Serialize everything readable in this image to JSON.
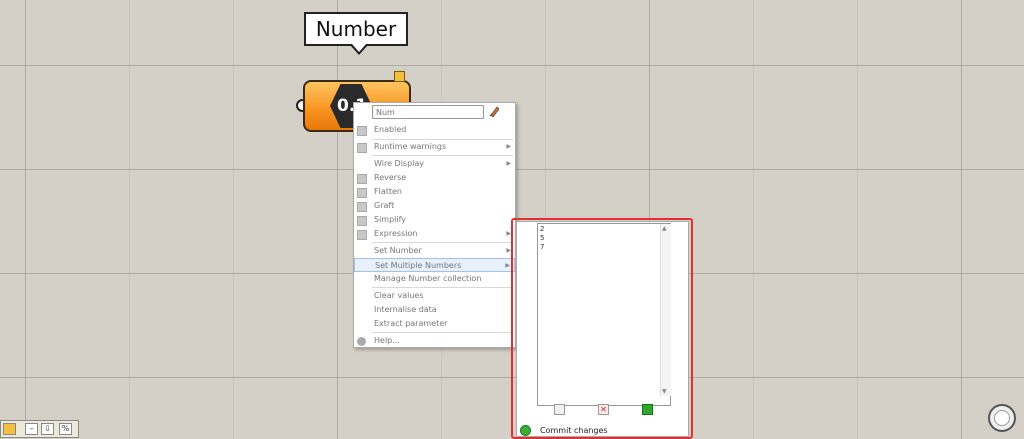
{
  "tooltip": {
    "label": "Number"
  },
  "component": {
    "icon_text": "0.1",
    "name_field_placeholder": "Num"
  },
  "menu": {
    "enabled": "Enabled",
    "runtime_warnings": "Runtime warnings",
    "wire_display": "Wire Display",
    "reverse": "Reverse",
    "flatten": "Flatten",
    "graft": "Graft",
    "simplify": "Simplify",
    "expression": "Expression",
    "set_number": "Set Number",
    "set_multiple_numbers": "Set Multiple Numbers",
    "manage_collection": "Manage Number collection",
    "clear_values": "Clear values",
    "internalise_data": "Internalise data",
    "extract_parameter": "Extract parameter",
    "help": "Help..."
  },
  "submenu": {
    "numbers": [
      "2",
      "5",
      "7"
    ],
    "commit_label": "Commit changes"
  },
  "colors": {
    "canvas": "#d4d0c8",
    "component_orange": "#f7911e",
    "highlight_red": "#e03030",
    "commit_green": "#3ab03a"
  }
}
